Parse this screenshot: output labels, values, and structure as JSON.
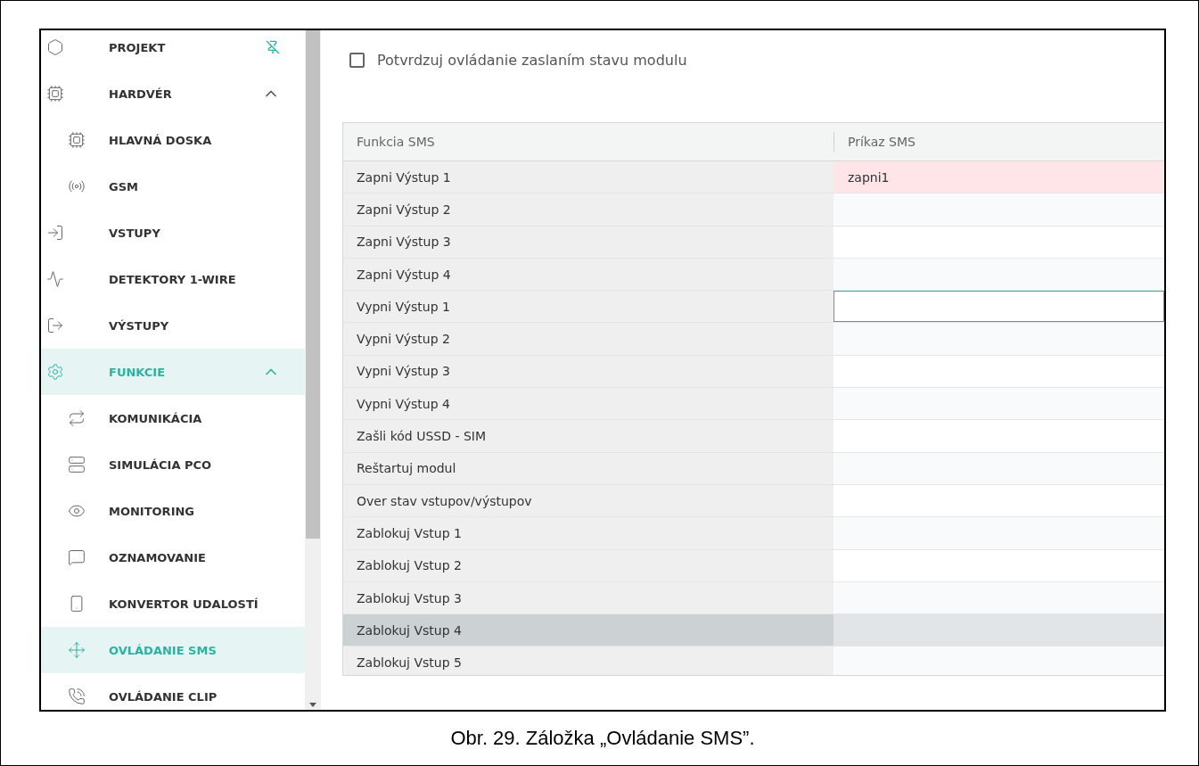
{
  "sidebar": {
    "items": [
      {
        "label": "PROJEKT",
        "selected": false,
        "pinned": false
      },
      {
        "label": "HARDVÉR",
        "selected": false,
        "expanded": true,
        "children": [
          {
            "label": "HLAVNÁ DOSKA",
            "selected": false
          },
          {
            "label": "GSM",
            "selected": false
          }
        ]
      },
      {
        "label": "VSTUPY",
        "selected": false
      },
      {
        "label": "DETEKTORY 1-WIRE",
        "selected": false
      },
      {
        "label": "VÝSTUPY",
        "selected": false
      },
      {
        "label": "FUNKCIE",
        "selected": true,
        "expanded": true,
        "children": [
          {
            "label": "KOMUNIKÁCIA",
            "selected": false
          },
          {
            "label": "SIMULÁCIA PCO",
            "selected": false
          },
          {
            "label": "MONITORING",
            "selected": false
          },
          {
            "label": "OZNAMOVANIE",
            "selected": false
          },
          {
            "label": "KONVERTOR UDALOSTÍ",
            "selected": false
          },
          {
            "label": "OVLÁDANIE SMS",
            "selected": true
          },
          {
            "label": "OVLÁDANIE CLIP",
            "selected": false
          }
        ]
      }
    ]
  },
  "confirm_checkbox": {
    "label": "Potvrdzuj ovládanie zaslaním stavu modulu",
    "checked": false
  },
  "table": {
    "columns": [
      "Funkcia SMS",
      "Príkaz SMS"
    ],
    "rows": [
      {
        "function": "Zapni Výstup 1",
        "command": "zapni1",
        "invalid": true,
        "focused": false,
        "hovered": false
      },
      {
        "function": "Zapni Výstup 2",
        "command": "",
        "invalid": false,
        "focused": false,
        "hovered": false
      },
      {
        "function": "Zapni Výstup 3",
        "command": "",
        "invalid": false,
        "focused": false,
        "hovered": false
      },
      {
        "function": "Zapni Výstup 4",
        "command": "",
        "invalid": false,
        "focused": false,
        "hovered": false
      },
      {
        "function": "Vypni Výstup 1",
        "command": "",
        "invalid": false,
        "focused": true,
        "hovered": false
      },
      {
        "function": "Vypni Výstup 2",
        "command": "",
        "invalid": false,
        "focused": false,
        "hovered": false
      },
      {
        "function": "Vypni Výstup 3",
        "command": "",
        "invalid": false,
        "focused": false,
        "hovered": false
      },
      {
        "function": "Vypni Výstup 4",
        "command": "",
        "invalid": false,
        "focused": false,
        "hovered": false
      },
      {
        "function": "Zašli kód USSD - SIM",
        "command": "",
        "invalid": false,
        "focused": false,
        "hovered": false
      },
      {
        "function": "Reštartuj modul",
        "command": "",
        "invalid": false,
        "focused": false,
        "hovered": false
      },
      {
        "function": "Over stav vstupov/výstupov",
        "command": "",
        "invalid": false,
        "focused": false,
        "hovered": false
      },
      {
        "function": "Zablokuj Vstup 1",
        "command": "",
        "invalid": false,
        "focused": false,
        "hovered": false
      },
      {
        "function": "Zablokuj Vstup 2",
        "command": "",
        "invalid": false,
        "focused": false,
        "hovered": false
      },
      {
        "function": "Zablokuj Vstup 3",
        "command": "",
        "invalid": false,
        "focused": false,
        "hovered": false
      },
      {
        "function": "Zablokuj Vstup 4",
        "command": "",
        "invalid": false,
        "focused": false,
        "hovered": true
      },
      {
        "function": "Zablokuj Vstup 5",
        "command": "",
        "invalid": false,
        "focused": false,
        "hovered": false
      }
    ]
  },
  "caption": "Obr. 29. Záložka „Ovládanie SMS”."
}
